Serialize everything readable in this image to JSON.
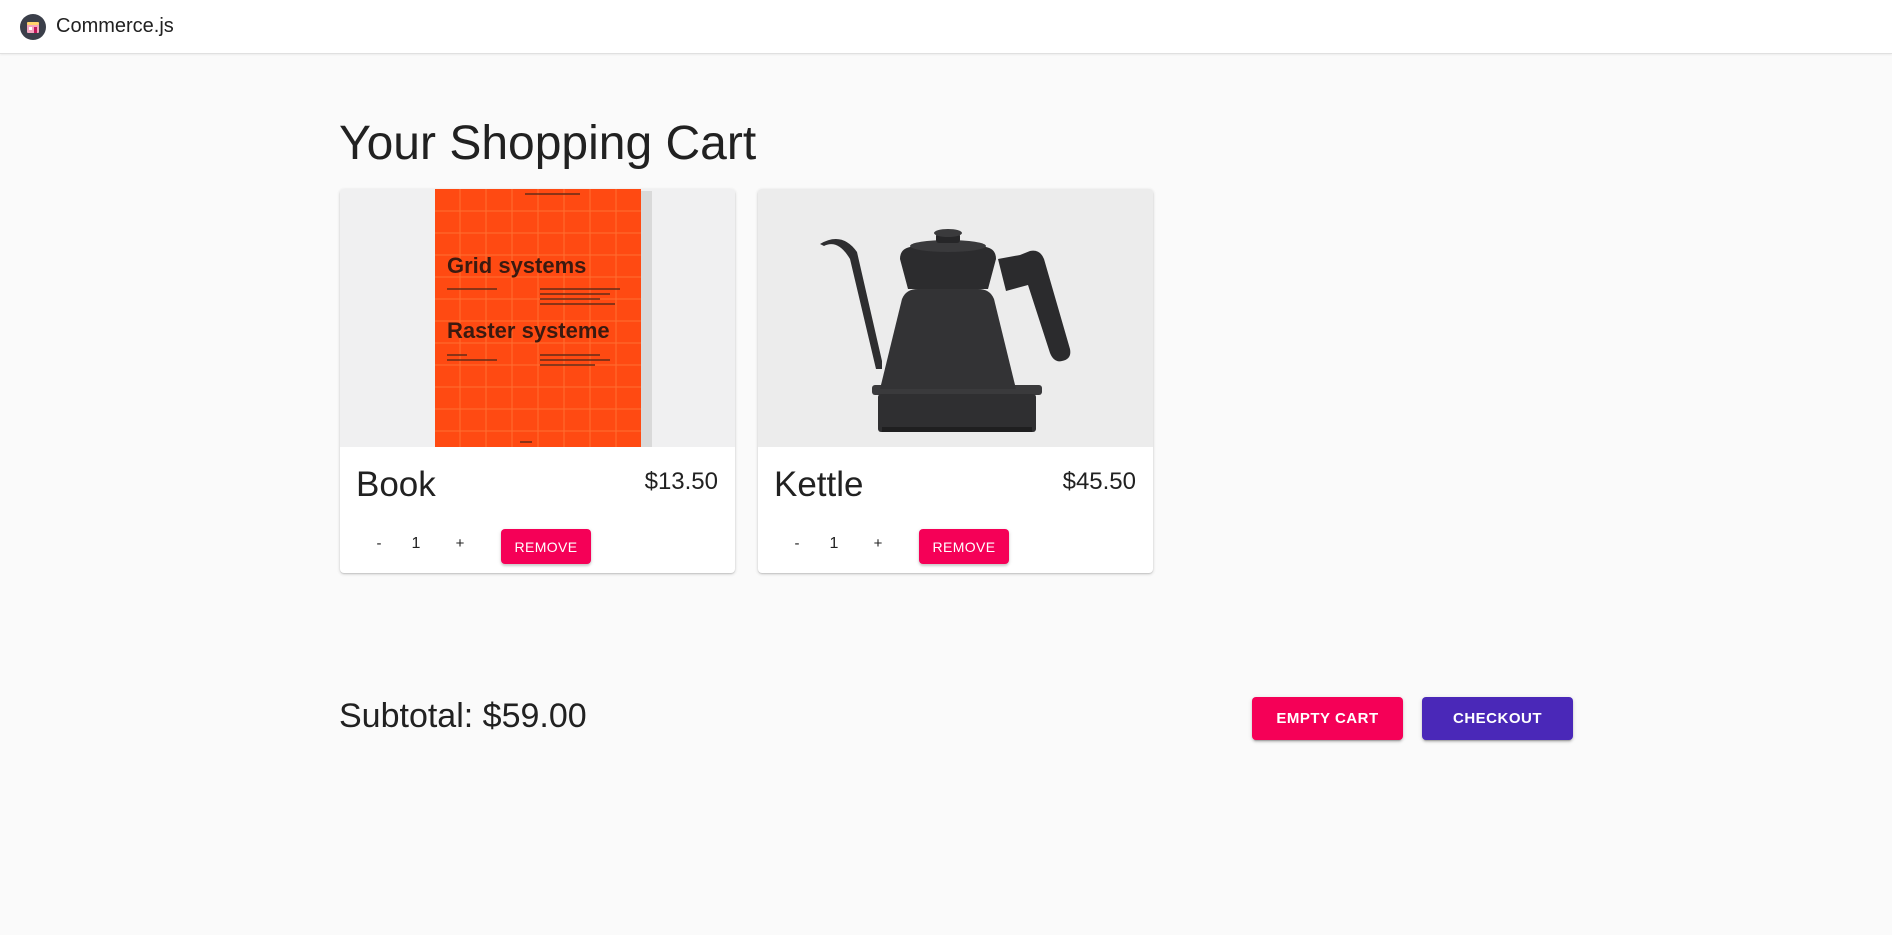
{
  "app": {
    "name": "Commerce.js",
    "logo_icon": "shop-icon"
  },
  "cart": {
    "title": "Your Shopping Cart",
    "items": [
      {
        "name": "Book",
        "price": "$13.50",
        "quantity": "1",
        "image_icon": "book-cover-image",
        "cover": {
          "title_1": "Grid systems",
          "title_2": "Raster systeme",
          "color": "#ff4a12"
        }
      },
      {
        "name": "Kettle",
        "price": "$45.50",
        "quantity": "1",
        "image_icon": "kettle-image"
      }
    ],
    "decrement_label": "-",
    "increment_label": "+",
    "remove_label": "Remove",
    "subtotal": "Subtotal: $59.00",
    "empty_label": "Empty cart",
    "checkout_label": "Checkout"
  },
  "colors": {
    "secondary": "#f50057",
    "primary": "#4a28b8",
    "background": "#fafafa"
  }
}
